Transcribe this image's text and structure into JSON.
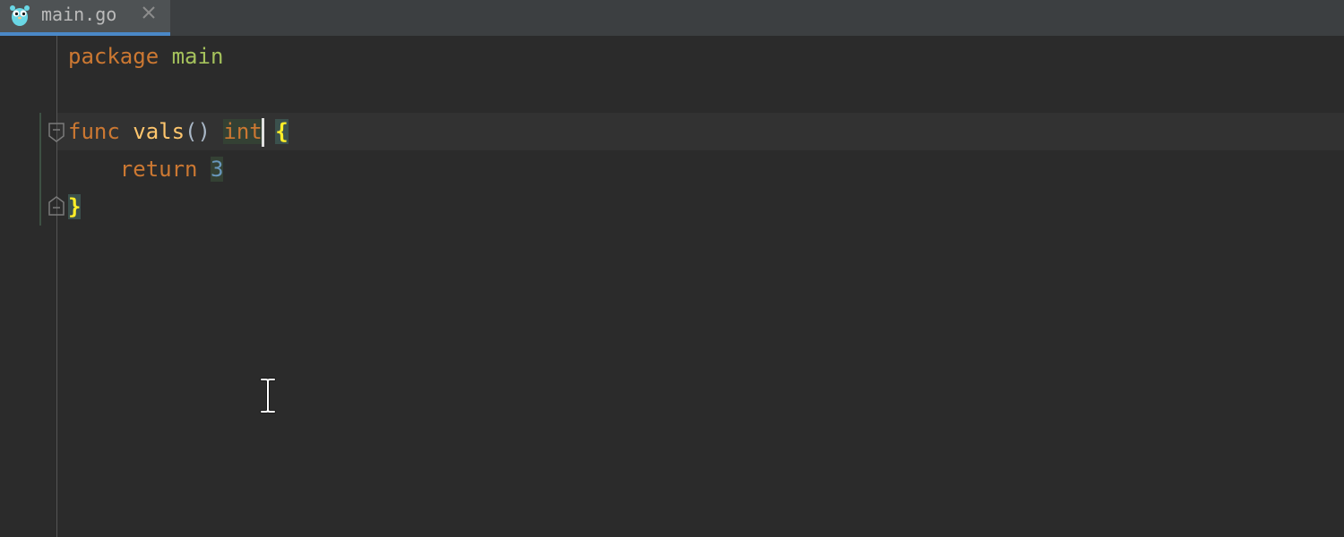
{
  "tab": {
    "filename": "main.go",
    "icon": "gopher-icon",
    "close_icon": "close-icon"
  },
  "code": {
    "line1": {
      "keyword": "package",
      "name": "main"
    },
    "line3": {
      "keyword": "func",
      "name": "vals",
      "parens": "()",
      "type": "int",
      "open_brace": "{"
    },
    "line4": {
      "keyword": "return",
      "value": "3"
    },
    "line5": {
      "close_brace": "}"
    }
  },
  "colors": {
    "background": "#2b2b2b",
    "tab_accent": "#4a88c7",
    "keyword": "#cc7832",
    "function": "#ffc66d",
    "number": "#6897bb",
    "brace": "#ffef28"
  }
}
